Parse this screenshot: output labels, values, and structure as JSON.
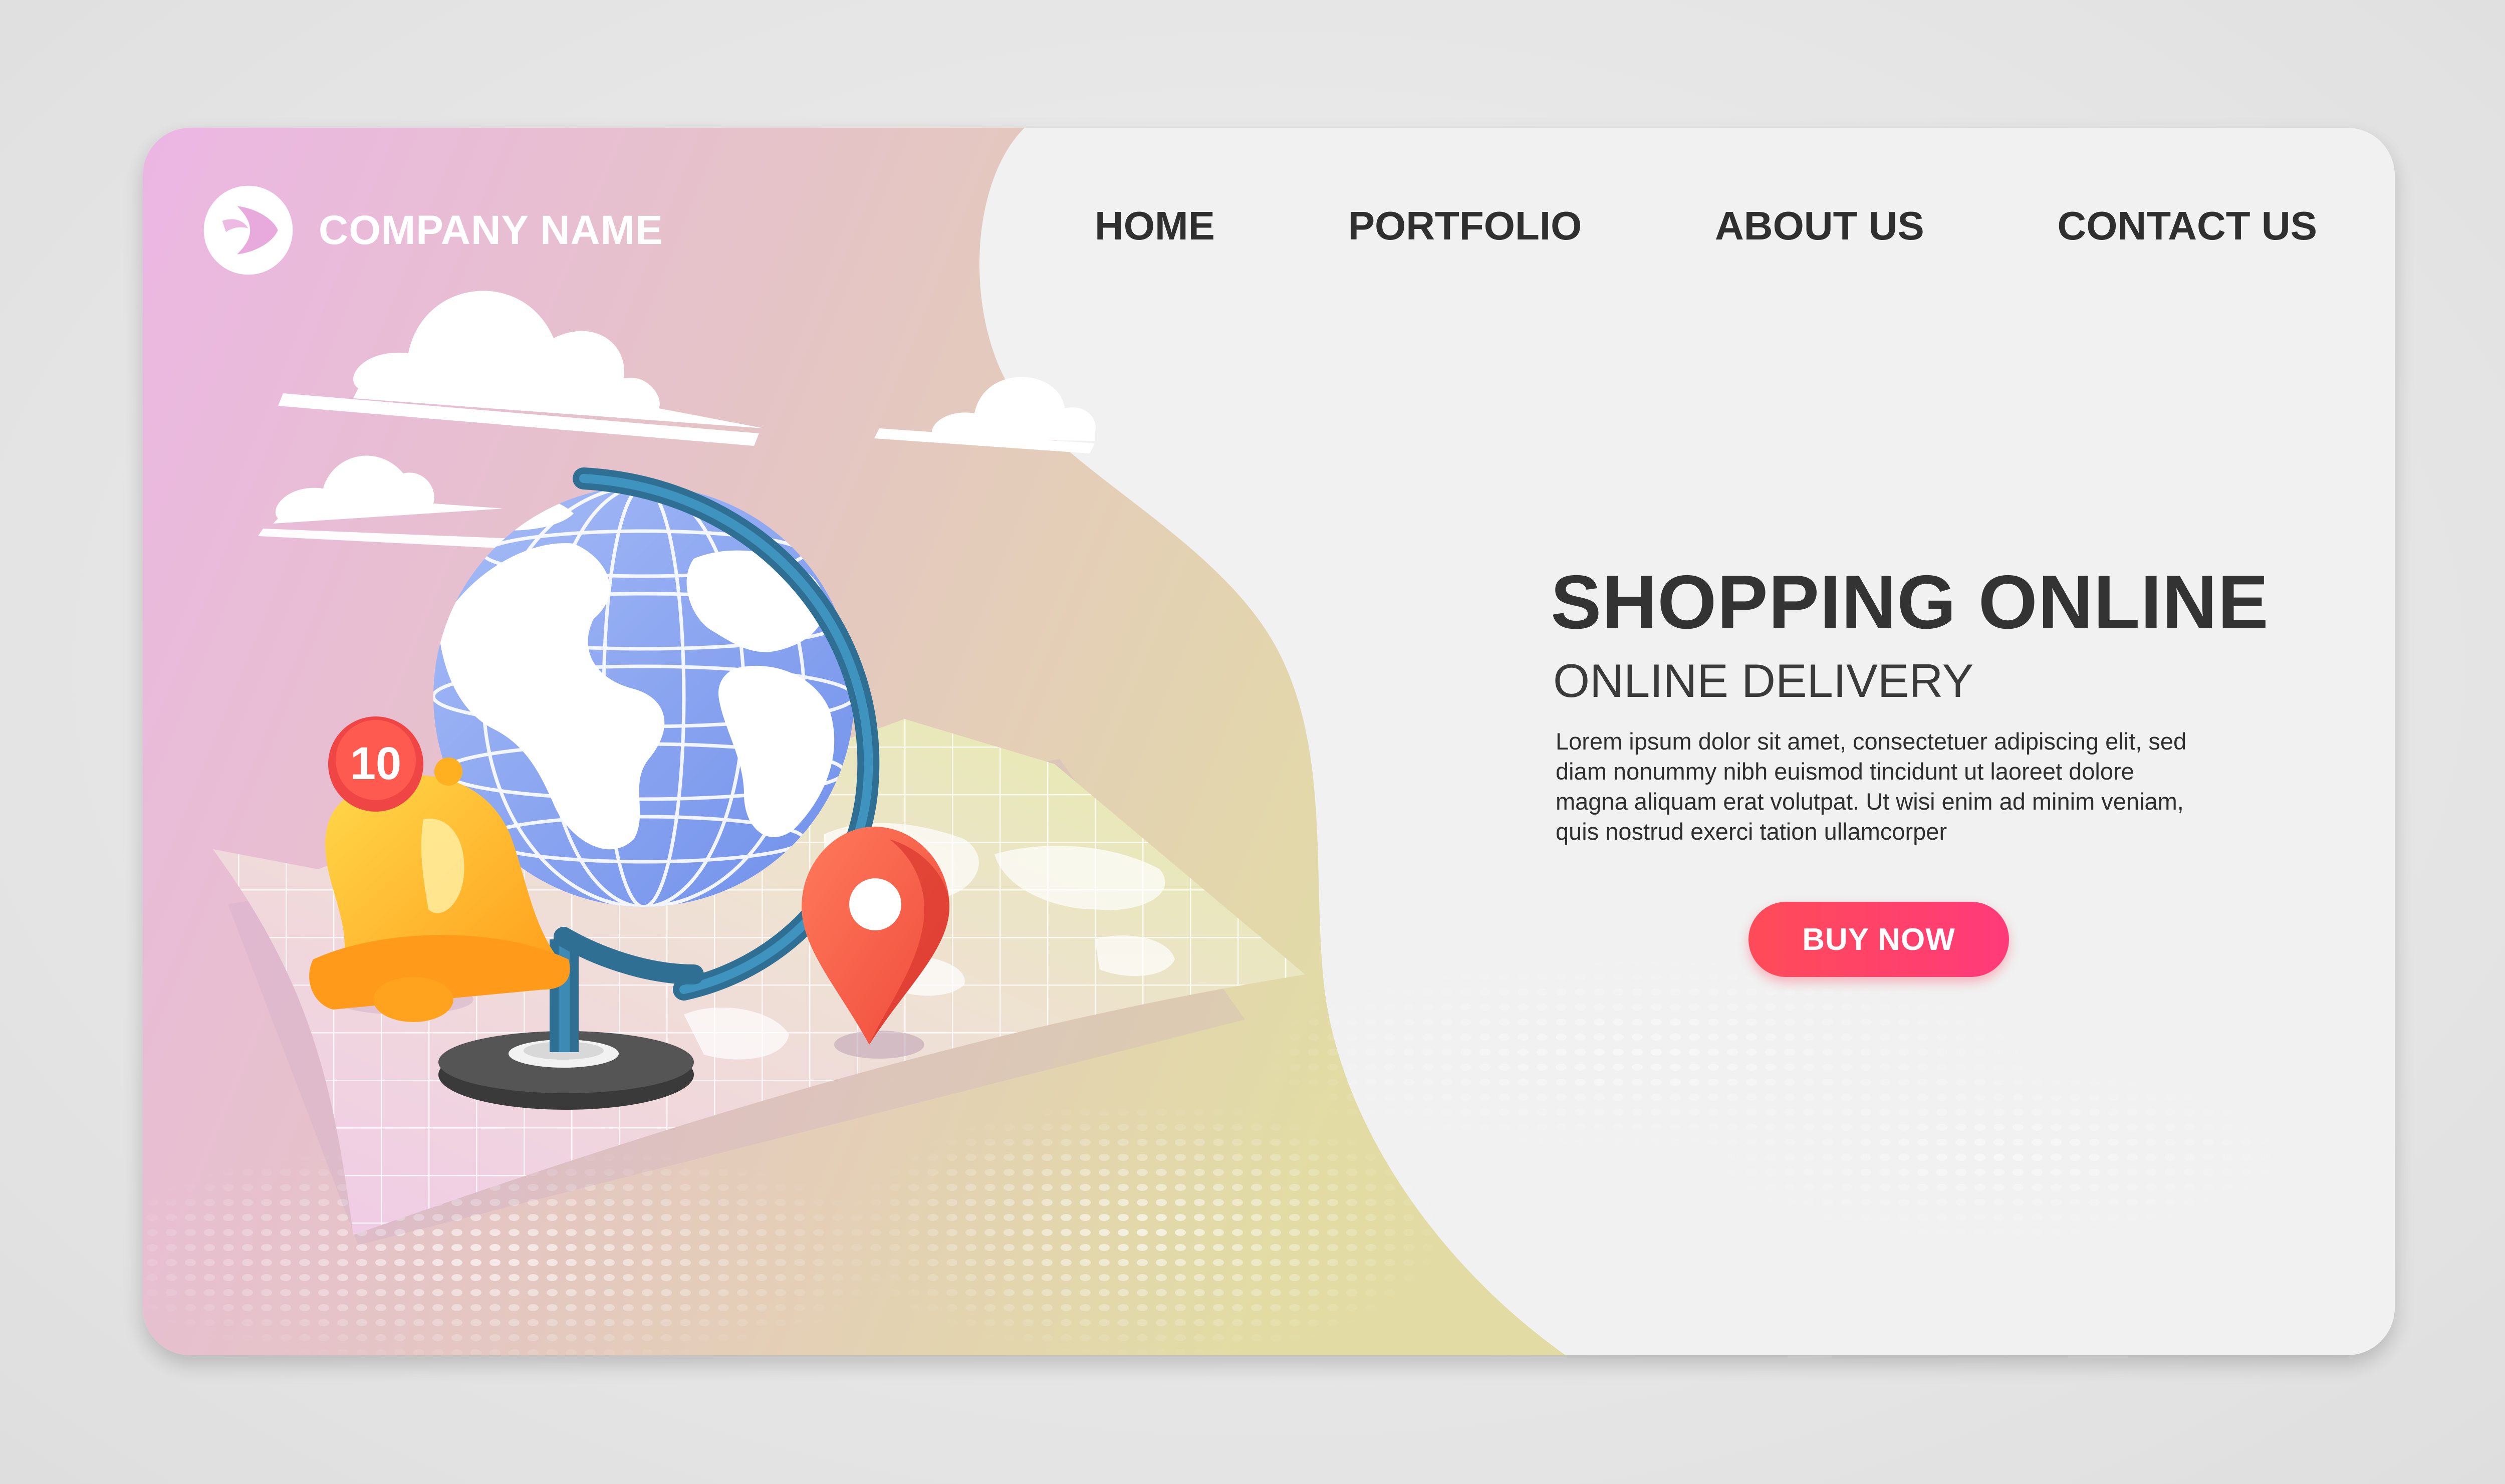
{
  "brand": {
    "company_name": "COMPANY NAME",
    "logo_icon": "play-circle-icon"
  },
  "nav": {
    "items": [
      {
        "label": "HOME"
      },
      {
        "label": "PORTFOLIO"
      },
      {
        "label": "ABOUT US"
      },
      {
        "label": "CONTACT US"
      }
    ]
  },
  "hero": {
    "title": "SHOPPING ONLINE",
    "subtitle": "ONLINE DELIVERY",
    "body": "Lorem ipsum dolor sit amet, consectetuer adipiscing elit, sed diam nonummy nibh euismod tincidunt ut laoreet dolore magna aliquam erat volutpat. Ut wisi enim ad minim veniam, quis nostrud exerci tation ullamcorper",
    "cta_label": "BUY NOW"
  },
  "illustration": {
    "notification_count": "10",
    "icons": [
      "cloud-icon",
      "globe-icon",
      "bell-icon",
      "map-pin-icon",
      "world-map-icon"
    ]
  },
  "colors": {
    "left_gradient_start": "#ecb8e4",
    "left_gradient_end": "#e3dba4",
    "panel_background": "#f1f1f1",
    "cta_start": "#ff4b58",
    "cta_end": "#ff3a7a",
    "text_dark": "#333333"
  }
}
